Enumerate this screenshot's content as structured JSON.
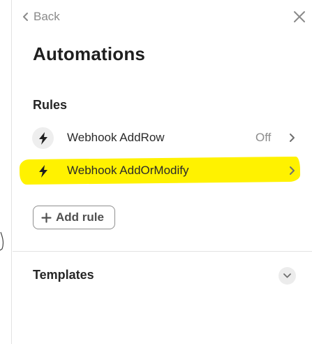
{
  "nav": {
    "back_label": "Back",
    "back_icon": "chevron-left-icon",
    "close_icon": "close-icon"
  },
  "page": {
    "title": "Automations"
  },
  "rules": {
    "section_label": "Rules",
    "items": [
      {
        "name": "Webhook AddRow",
        "status": "Off",
        "icon": "lightning-icon",
        "highlighted": false
      },
      {
        "name": "Webhook AddOrModify",
        "status": "",
        "icon": "lightning-icon",
        "highlighted": true
      }
    ],
    "add_label": "Add rule"
  },
  "templates": {
    "section_label": "Templates",
    "toggle_icon": "chevron-down-icon"
  },
  "colors": {
    "highlight": "#fff200",
    "muted_text": "#8c8c8c",
    "divider": "#e2e2e2"
  }
}
